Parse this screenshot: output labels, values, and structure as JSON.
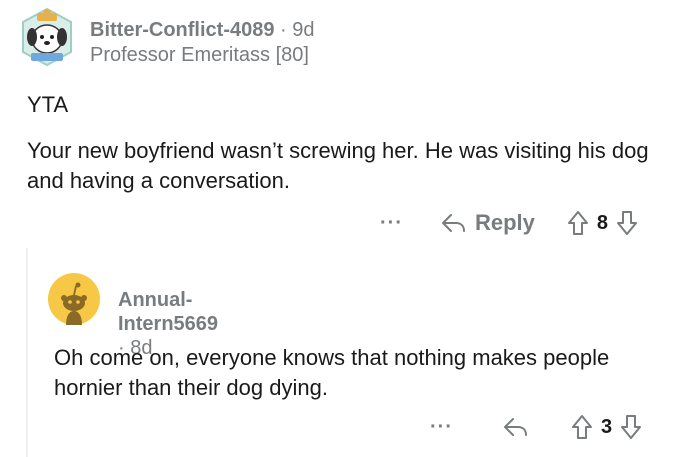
{
  "comment": {
    "username": "Bitter-Conflict-4089",
    "separator": "·",
    "age": "9d",
    "flair": "Professor Emeritass [80]",
    "paragraphs": [
      "YTA",
      "Your new boyfriend wasn’t screwing her. He was visiting his dog and having a conversation."
    ],
    "more_label": "···",
    "reply_label": "Reply",
    "score": "8"
  },
  "reply": {
    "username": "Annual-Intern5669",
    "separator": "·",
    "age": "8d",
    "text": "Oh come on, everyone knows that nothing makes people hornier than their dog dying.",
    "more_label": "···",
    "score": "3"
  },
  "colors": {
    "meta_gray": "#787c7e",
    "text": "#1a1a1b",
    "thread_line": "#edeff1",
    "avatar2_bg": "#f7c846"
  },
  "icons": [
    "dog-avatar-icon",
    "snoo-avatar-icon",
    "reply-arrow-icon",
    "upvote-icon",
    "downvote-icon"
  ]
}
